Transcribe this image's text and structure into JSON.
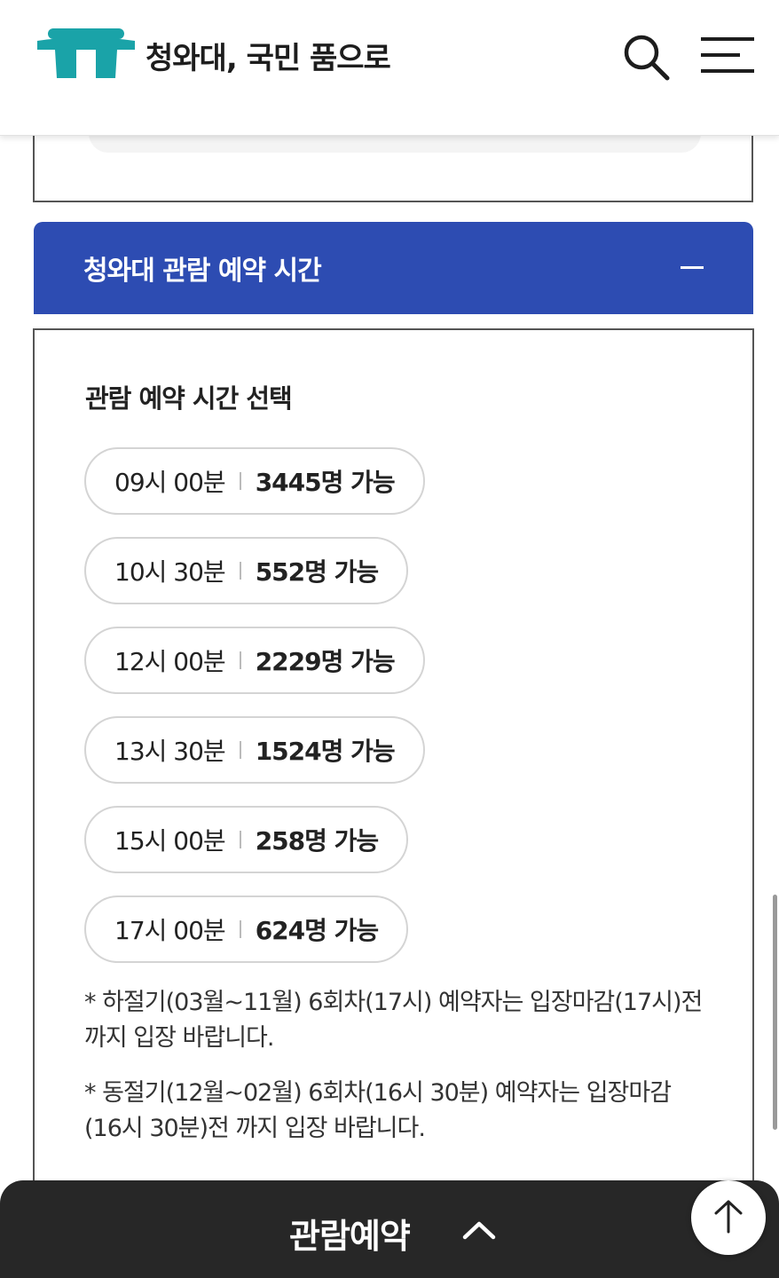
{
  "header": {
    "site_title": "청와대, 국민 품으로",
    "logo_icon": "blue-house-gate-logo-icon",
    "search_icon": "search-icon",
    "menu_icon": "hamburger-menu-icon",
    "brand_color": "#1aa3a8"
  },
  "accordion": {
    "title": "청와대 관람 예약 시간",
    "toggle_icon": "collapse-minus-icon",
    "header_color": "#2d4cb2"
  },
  "reservation": {
    "section_label": "관람 예약 시간 선택",
    "slots": [
      {
        "time": "09시 00분",
        "count": "3445명 가능"
      },
      {
        "time": "10시 30분",
        "count": "552명 가능"
      },
      {
        "time": "12시 00분",
        "count": "2229명 가능"
      },
      {
        "time": "13시 30분",
        "count": "1524명 가능"
      },
      {
        "time": "15시 00분",
        "count": "258명 가능"
      },
      {
        "time": "17시 00분",
        "count": "624명 가능"
      }
    ],
    "notes": [
      "* 하절기(03월~11월) 6회차(17시) 예약자는 입장마감(17시)전 까지 입장 바랍니다.",
      "* 동절기(12월~02월) 6회차(16시 30분) 예약자는 입장마감(16시 30분)전 까지 입장 바랍니다."
    ]
  },
  "bottom_bar": {
    "label": "관람예약",
    "chevron_icon": "chevron-up-icon",
    "background": "#272727"
  },
  "scroll_top": {
    "icon": "arrow-up-icon"
  }
}
